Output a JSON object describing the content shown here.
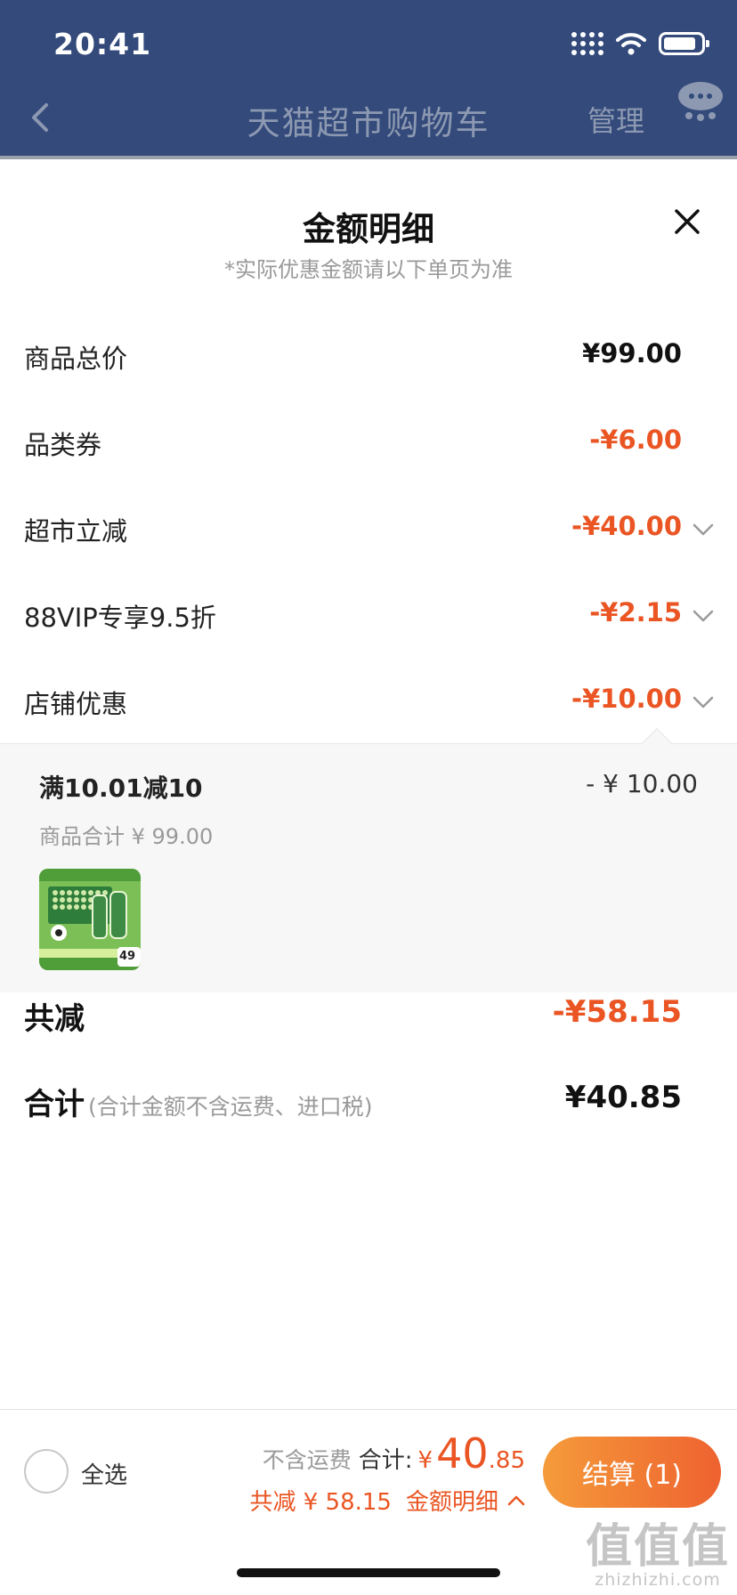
{
  "status_bar": {
    "time": "20:41"
  },
  "nav": {
    "title": "天猫超市购物车",
    "manage": "管理"
  },
  "sheet": {
    "title": "金额明细",
    "subtitle": "*实际优惠金额请以下单页为准",
    "rows": [
      {
        "label": "商品总价",
        "value": "¥99.00"
      },
      {
        "label": "品类券",
        "value": "-¥6.00"
      },
      {
        "label": "超市立减",
        "value": "-¥40.00"
      },
      {
        "label": "88VIP专享9.5折",
        "value": "-¥2.15"
      },
      {
        "label": "店铺优惠",
        "value": "-¥10.00"
      }
    ],
    "store_promo": {
      "name": "满10.01减10",
      "amount": "- ¥ 10.00",
      "subtotal": "商品合计 ¥ 99.00",
      "thumb_price": "49"
    },
    "total_discount": {
      "label": "共减",
      "value": "-¥58.15"
    },
    "grand_total": {
      "label": "合计",
      "note": "(合计金额不含运费、进口税)",
      "value": "¥40.85"
    }
  },
  "bottom_bar": {
    "select_all": "全选",
    "shipping_note": "不含运费",
    "total_prefix": "合计:",
    "currency": "¥",
    "price_int": "40",
    "price_dec": ".85",
    "discount_text": "共减 ¥ 58.15",
    "details_label": "金额明细",
    "checkout": "结算 (1)"
  },
  "watermark": {
    "big": "值值值",
    "small": "zhizhizhi.com"
  },
  "colors": {
    "accent": "#ea5523",
    "header": "#334a7b",
    "checkout_start": "#f59b3a",
    "checkout_end": "#ee6230"
  }
}
